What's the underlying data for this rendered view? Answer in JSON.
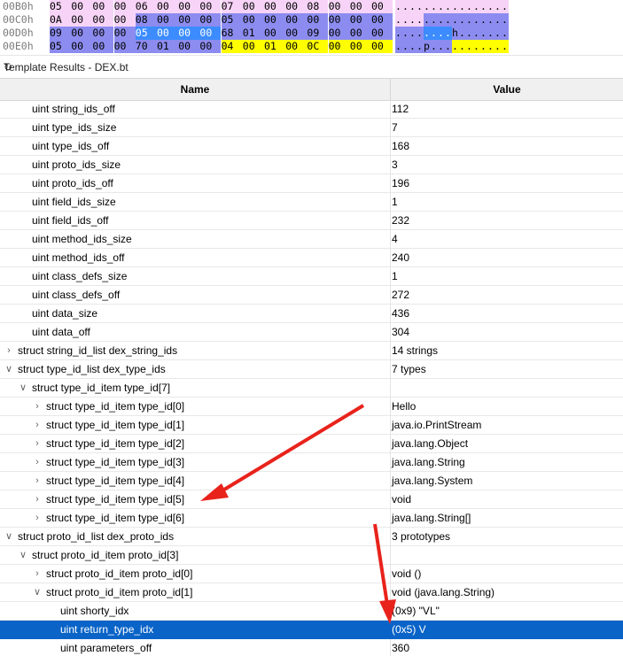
{
  "hex": {
    "rows": [
      {
        "addr": "00B0h",
        "bytes": [
          "05",
          "00",
          "00",
          "00",
          "06",
          "00",
          "00",
          "00",
          "07",
          "00",
          "00",
          "00",
          "08",
          "00",
          "00",
          "00"
        ],
        "ascii": "................"
      },
      {
        "addr": "00C0h",
        "bytes": [
          "0A",
          "00",
          "00",
          "00",
          "08",
          "00",
          "00",
          "00",
          "05",
          "00",
          "00",
          "00",
          "00",
          "00",
          "00",
          "00"
        ],
        "ascii": "................"
      },
      {
        "addr": "00D0h",
        "bytes": [
          "09",
          "00",
          "00",
          "00",
          "05",
          "00",
          "00",
          "00",
          "68",
          "01",
          "00",
          "00",
          "09",
          "00",
          "00",
          "00"
        ],
        "ascii": "........h......."
      },
      {
        "addr": "00E0h",
        "bytes": [
          "05",
          "00",
          "00",
          "00",
          "70",
          "01",
          "00",
          "00",
          "04",
          "00",
          "01",
          "00",
          "0C",
          "00",
          "00",
          "00"
        ],
        "ascii": "....p..........."
      }
    ]
  },
  "panel": {
    "title": "Template Results - DEX.bt",
    "refresh_icon": "refresh-icon"
  },
  "table": {
    "headers": {
      "name": "Name",
      "value": "Value"
    },
    "rows": [
      {
        "name": "uint string_ids_off",
        "value": "112",
        "indent": 2,
        "expander": ""
      },
      {
        "name": "uint type_ids_size",
        "value": "7",
        "indent": 2,
        "expander": ""
      },
      {
        "name": "uint type_ids_off",
        "value": "168",
        "indent": 2,
        "expander": ""
      },
      {
        "name": "uint proto_ids_size",
        "value": "3",
        "indent": 2,
        "expander": ""
      },
      {
        "name": "uint proto_ids_off",
        "value": "196",
        "indent": 2,
        "expander": ""
      },
      {
        "name": "uint field_ids_size",
        "value": "1",
        "indent": 2,
        "expander": ""
      },
      {
        "name": "uint field_ids_off",
        "value": "232",
        "indent": 2,
        "expander": ""
      },
      {
        "name": "uint method_ids_size",
        "value": "4",
        "indent": 2,
        "expander": ""
      },
      {
        "name": "uint method_ids_off",
        "value": "240",
        "indent": 2,
        "expander": ""
      },
      {
        "name": "uint class_defs_size",
        "value": "1",
        "indent": 2,
        "expander": ""
      },
      {
        "name": "uint class_defs_off",
        "value": "272",
        "indent": 2,
        "expander": ""
      },
      {
        "name": "uint data_size",
        "value": "436",
        "indent": 2,
        "expander": ""
      },
      {
        "name": "uint data_off",
        "value": "304",
        "indent": 2,
        "expander": ""
      },
      {
        "name": "struct string_id_list dex_string_ids",
        "value": "14 strings",
        "indent": 0,
        "expander": "collapsed"
      },
      {
        "name": "struct type_id_list dex_type_ids",
        "value": "7 types",
        "indent": 0,
        "expander": "expanded"
      },
      {
        "name": "struct type_id_item type_id[7]",
        "value": "",
        "indent": 1,
        "expander": "expanded"
      },
      {
        "name": "struct type_id_item type_id[0]",
        "value": "Hello",
        "indent": 2,
        "expander": "collapsed"
      },
      {
        "name": "struct type_id_item type_id[1]",
        "value": "java.io.PrintStream",
        "indent": 2,
        "expander": "collapsed"
      },
      {
        "name": "struct type_id_item type_id[2]",
        "value": "java.lang.Object",
        "indent": 2,
        "expander": "collapsed"
      },
      {
        "name": "struct type_id_item type_id[3]",
        "value": "java.lang.String",
        "indent": 2,
        "expander": "collapsed"
      },
      {
        "name": "struct type_id_item type_id[4]",
        "value": "java.lang.System",
        "indent": 2,
        "expander": "collapsed"
      },
      {
        "name": "struct type_id_item type_id[5]",
        "value": "void",
        "indent": 2,
        "expander": "collapsed"
      },
      {
        "name": "struct type_id_item type_id[6]",
        "value": "java.lang.String[]",
        "indent": 2,
        "expander": "collapsed"
      },
      {
        "name": "struct proto_id_list dex_proto_ids",
        "value": "3 prototypes",
        "indent": 0,
        "expander": "expanded"
      },
      {
        "name": "struct proto_id_item proto_id[3]",
        "value": "",
        "indent": 1,
        "expander": "expanded"
      },
      {
        "name": "struct proto_id_item proto_id[0]",
        "value": "void ()",
        "indent": 2,
        "expander": "collapsed"
      },
      {
        "name": "struct proto_id_item proto_id[1]",
        "value": "void (java.lang.String)",
        "indent": 2,
        "expander": "expanded"
      },
      {
        "name": "uint shorty_idx",
        "value": "(0x9) \"VL\"",
        "indent": 4,
        "expander": ""
      },
      {
        "name": "uint return_type_idx",
        "value": "(0x5) V",
        "indent": 4,
        "expander": "",
        "selected": true
      },
      {
        "name": "uint parameters_off",
        "value": "360",
        "indent": 4,
        "expander": ""
      }
    ]
  },
  "colors": {
    "selection": "#0a64c8",
    "annotation_arrow": "#e8231c",
    "hex_pink": "#f7d4f7",
    "hex_blue": "#8c8cf0",
    "hex_yellow": "#ffff00"
  }
}
